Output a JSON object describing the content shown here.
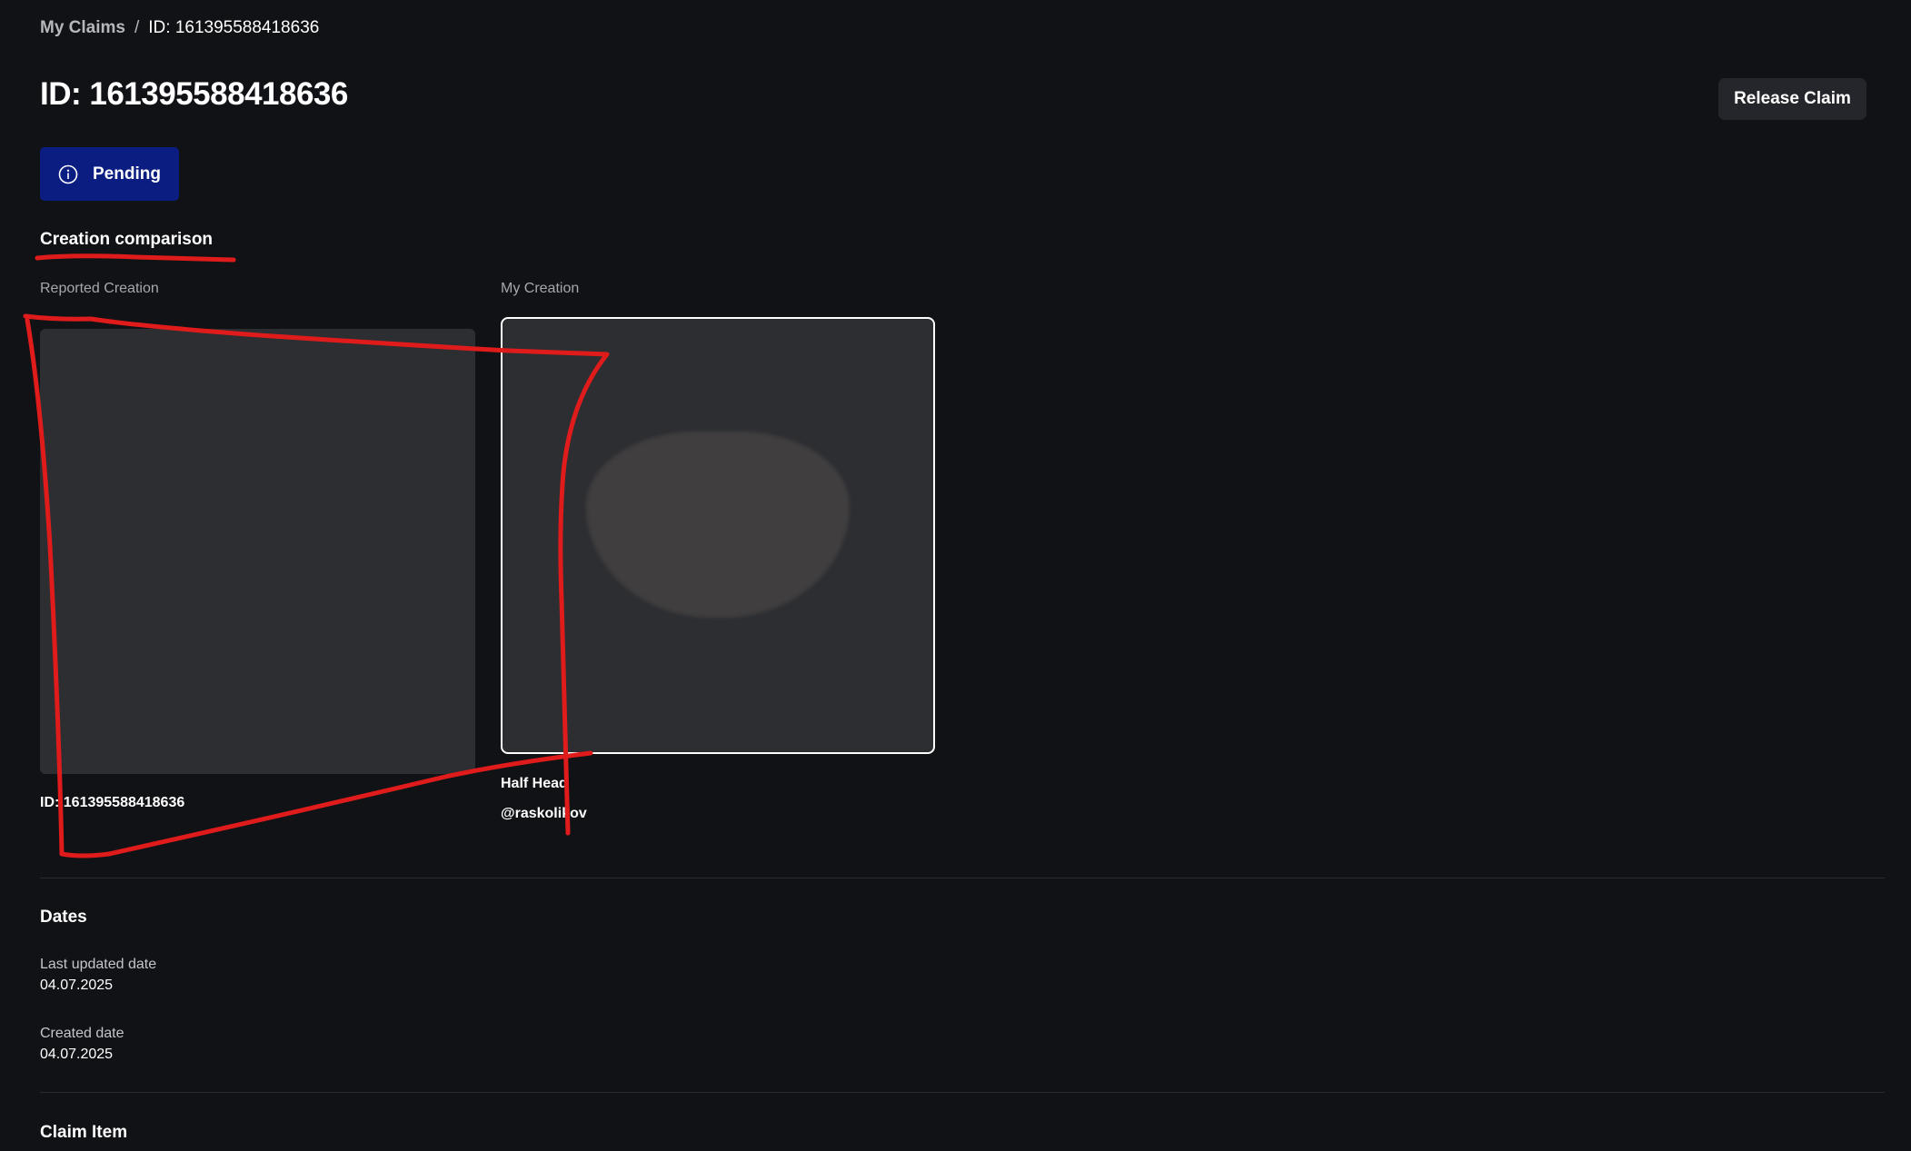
{
  "breadcrumb": {
    "parent": "My Claims",
    "separator": "/",
    "current": "ID: 161395588418636"
  },
  "header": {
    "title": "ID: 161395588418636",
    "release_button": "Release Claim"
  },
  "status": {
    "label": "Pending",
    "icon": "info-circle-icon",
    "color": "#0b1d80"
  },
  "comparison": {
    "heading": "Creation comparison",
    "reported": {
      "label": "Reported Creation",
      "id_text": "ID: 161395588418636"
    },
    "mine": {
      "label": "My Creation",
      "name": "Half Head",
      "creator": "@raskolikov"
    }
  },
  "dates": {
    "heading": "Dates",
    "last_updated_label": "Last updated date",
    "last_updated_value": "04.07.2025",
    "created_label": "Created date",
    "created_value": "04.07.2025"
  },
  "claim_item": {
    "heading": "Claim Item"
  },
  "annotation_color": "#e01b1b"
}
